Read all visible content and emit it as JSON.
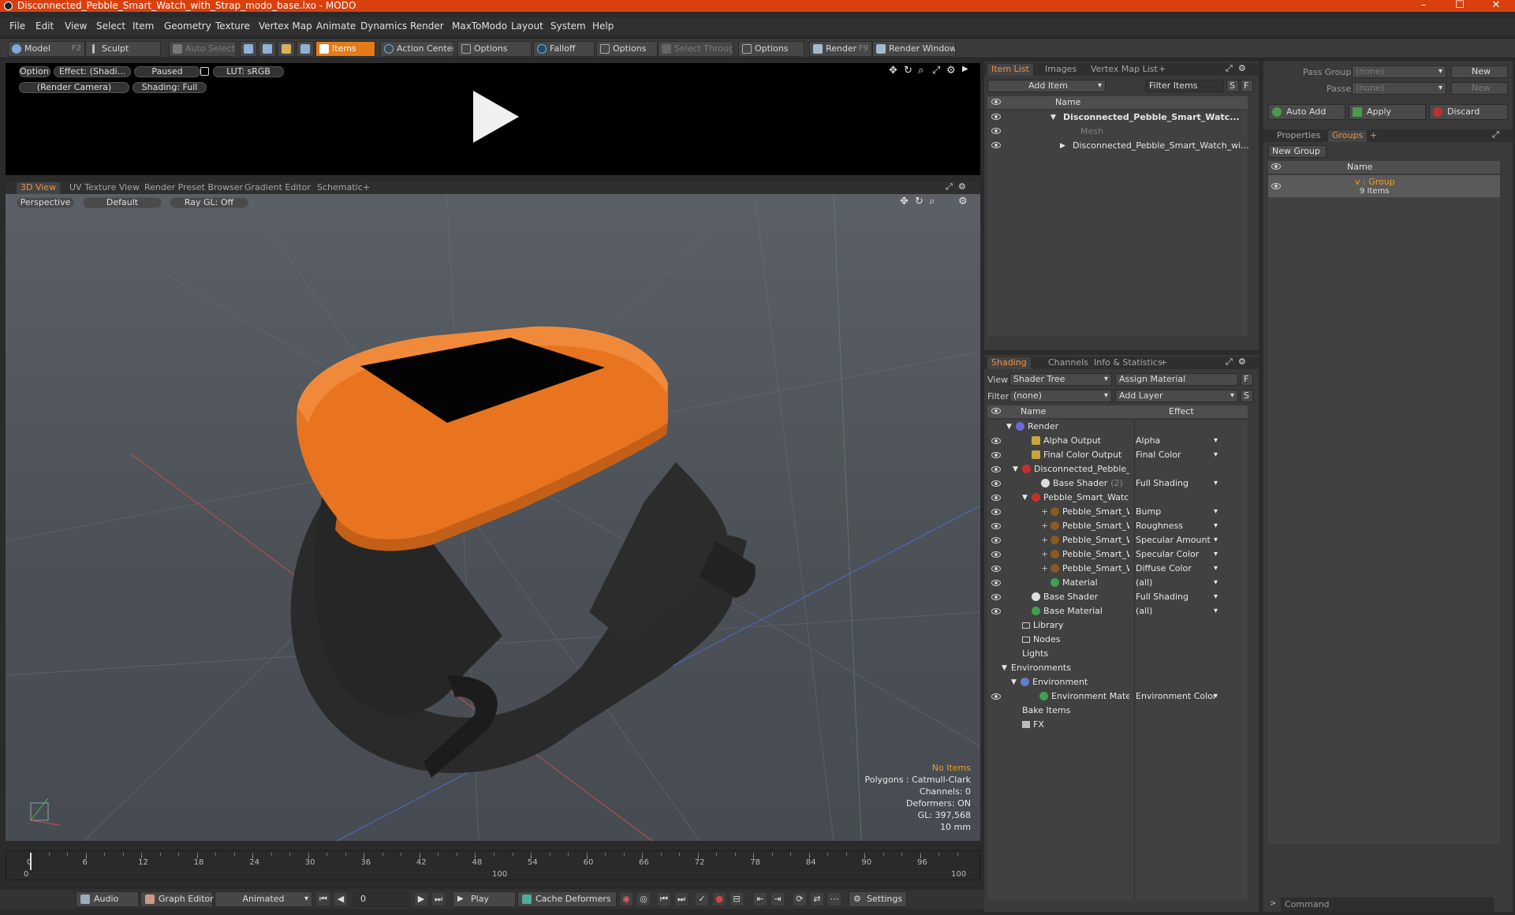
{
  "window": {
    "title": "Disconnected_Pebble_Smart_Watch_with_Strap_modo_base.lxo - MODO",
    "minimize": "–",
    "maximize": "☐",
    "close": "✕"
  },
  "menu": [
    "File",
    "Edit",
    "View",
    "Select",
    "Item",
    "Geometry",
    "Texture",
    "Vertex Map",
    "Animate",
    "Dynamics",
    "Render",
    "MaxToModo",
    "Layout",
    "System",
    "Help"
  ],
  "toolbar": {
    "model": "Model",
    "model_key": "F2",
    "sculpt": "Sculpt",
    "auto_select": "Auto Select",
    "items": "Items",
    "action_center": "Action Center",
    "options1": "Options",
    "falloff": "Falloff",
    "options2": "Options",
    "select_through": "Select Through",
    "options3": "Options",
    "render": "Render",
    "render_key": "F9",
    "render_window": "Render Window"
  },
  "preview": {
    "options": "Options",
    "effect": "Effect: (Shadi...",
    "paused": "Paused",
    "lut": "LUT: sRGB",
    "camera": "(Render Camera)",
    "shading": "Shading: Full"
  },
  "view_tabs": [
    "3D View",
    "UV Texture View",
    "Render Preset Browser",
    "Gradient Editor",
    "Schematic"
  ],
  "viewport": {
    "perspective": "Perspective",
    "default": "Default",
    "raygl": "Ray GL: Off",
    "hud": {
      "no_items": "No Items",
      "polygons": "Polygons : Catmull-Clark",
      "channels": "Channels: 0",
      "deformers": "Deformers: ON",
      "gl": "GL: 397,568",
      "scale": "10 mm"
    }
  },
  "timeline": {
    "ticks": [
      "0",
      "6",
      "12",
      "18",
      "24",
      "30",
      "36",
      "42",
      "48",
      "54",
      "60",
      "66",
      "72",
      "78",
      "84",
      "90",
      "96"
    ],
    "bottom_ticks": [
      "0",
      "100",
      "100"
    ]
  },
  "bottombar": {
    "audio": "Audio",
    "graph_editor": "Graph Editor",
    "animated": "Animated",
    "frame": "0",
    "play": "Play",
    "cache_deformers": "Cache Deformers",
    "settings": "Settings"
  },
  "item_list": {
    "tabs": [
      "Item List",
      "Images",
      "Vertex Map List"
    ],
    "add_item": "Add Item",
    "filter_items": "Filter Items",
    "s_btn": "S",
    "f_btn": "F",
    "col_name": "Name",
    "rows": [
      {
        "label": "Disconnected_Pebble_Smart_Watc...",
        "bold": true
      },
      {
        "label": "Mesh",
        "dim": true
      },
      {
        "label": "Disconnected_Pebble_Smart_Watch_wi..."
      }
    ]
  },
  "shading": {
    "tabs": [
      "Shading",
      "Channels",
      "Info & Statistics"
    ],
    "view_label": "View",
    "view_value": "Shader Tree",
    "assign_material": "Assign Material",
    "f_btn": "F",
    "filter_label": "Filter",
    "filter_value": "(none)",
    "add_layer": "Add Layer",
    "s_btn": "S",
    "col_name": "Name",
    "col_effect": "Effect",
    "rows": [
      {
        "label": "Render",
        "effect": ""
      },
      {
        "label": "Alpha Output",
        "effect": "Alpha"
      },
      {
        "label": "Final Color Output",
        "effect": "Final Color"
      },
      {
        "label": "Disconnected_Pebble_Smar ...",
        "effect": ""
      },
      {
        "label": "Base Shader",
        "suffix": "(2)",
        "effect": "Full Shading"
      },
      {
        "label": "Pebble_Smart_Watch_ge...",
        "effect": ""
      },
      {
        "label": "Pebble_Smart_Watch_...",
        "effect": "Bump"
      },
      {
        "label": "Pebble_Smart_Watch_...",
        "effect": "Roughness"
      },
      {
        "label": "Pebble_Smart_Watch_...",
        "effect": "Specular Amount"
      },
      {
        "label": "Pebble_Smart_Watch_...",
        "effect": "Specular Color"
      },
      {
        "label": "Pebble_Smart_Watch_...",
        "effect": "Diffuse Color"
      },
      {
        "label": "Material",
        "effect": "(all)"
      },
      {
        "label": "Base Shader",
        "effect": "Full Shading"
      },
      {
        "label": "Base Material",
        "effect": "(all)"
      },
      {
        "label": "Library",
        "effect": ""
      },
      {
        "label": "Nodes",
        "effect": ""
      },
      {
        "label": "Lights",
        "effect": ""
      },
      {
        "label": "Environments",
        "effect": ""
      },
      {
        "label": "Environment",
        "effect": ""
      },
      {
        "label": "Environment Material",
        "effect": "Environment Color"
      },
      {
        "label": "Bake Items",
        "effect": ""
      },
      {
        "label": "FX",
        "effect": ""
      }
    ]
  },
  "groups": {
    "pass_groups_label": "Pass Groups",
    "pass_groups_value": "(none)",
    "passes_label": "Passes",
    "passes_value": "(none)",
    "new1": "New",
    "new2": "New",
    "auto_add": "Auto Add",
    "apply": "Apply",
    "discard": "Discard",
    "tabs": [
      "Properties",
      "Groups"
    ],
    "new_group": "New Group",
    "col_name": "Name",
    "group_name": "v : Group",
    "group_count": "9 Items",
    "command_placeholder": "Command"
  },
  "colors": {
    "accent": "#e57a18",
    "titlebar": "#d9400d",
    "watch_body": "#e8741f",
    "strap": "#2a2a2a"
  }
}
